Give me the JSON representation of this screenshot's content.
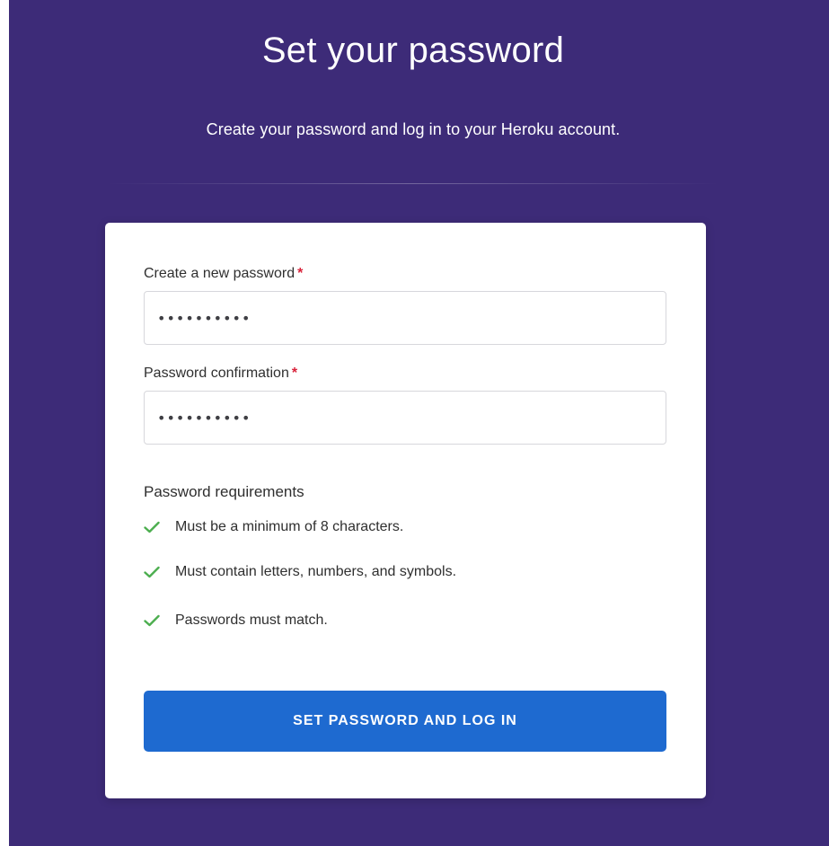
{
  "header": {
    "title": "Set your password",
    "subtitle": "Create your password and log in to your Heroku account."
  },
  "form": {
    "new_password": {
      "label": "Create a new password",
      "required_marker": "*",
      "value": "••••••••••"
    },
    "confirm_password": {
      "label": "Password confirmation",
      "required_marker": "*",
      "value": "••••••••••"
    },
    "requirements": {
      "heading": "Password requirements",
      "items": [
        {
          "text": "Must be a minimum of 8 characters.",
          "icon": "check-icon",
          "met": true
        },
        {
          "text": "Must contain letters, numbers, and symbols.",
          "icon": "check-icon",
          "met": true
        },
        {
          "text": "Passwords must match.",
          "icon": "check-icon",
          "met": true
        }
      ]
    },
    "submit_label": "SET PASSWORD AND LOG IN"
  },
  "colors": {
    "background": "#3d2b78",
    "card": "#ffffff",
    "button": "#1e6ad0",
    "check": "#4cae4f",
    "required": "#d9223a"
  }
}
